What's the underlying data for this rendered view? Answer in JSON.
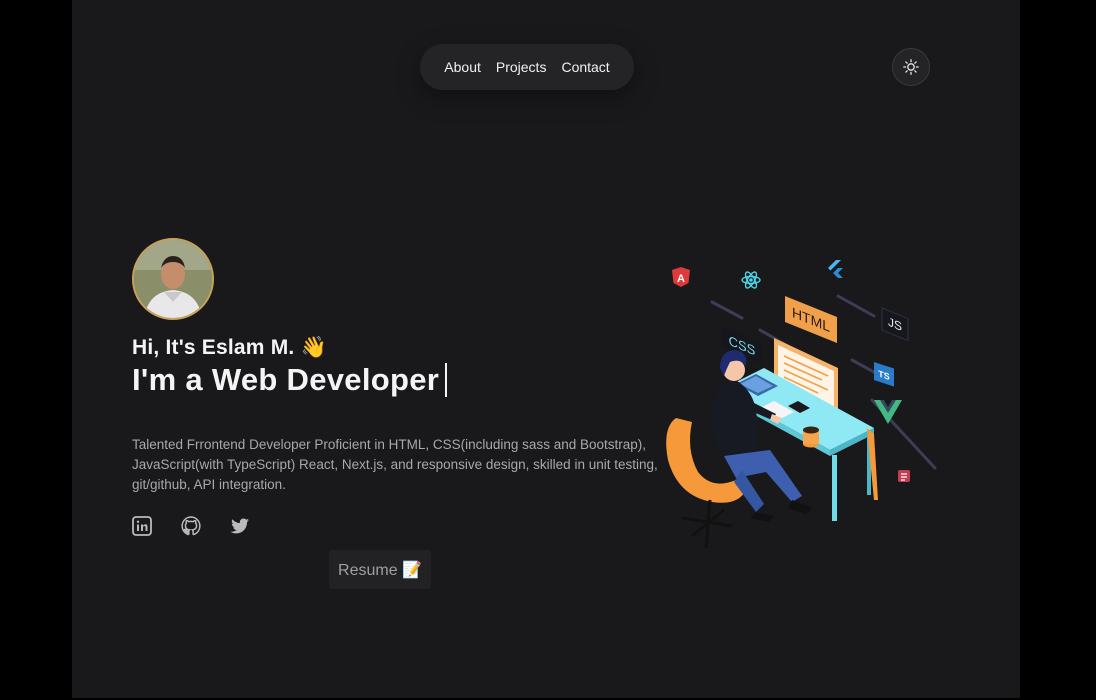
{
  "nav": {
    "items": [
      "About",
      "Projects",
      "Contact"
    ]
  },
  "theme_toggle": {
    "icon": "sun-icon"
  },
  "hero": {
    "greeting": "Hi, It's Eslam M. 👋",
    "role": "I'm a Web Developer",
    "description": "Talented Frrontend Developer Proficient in HTML, CSS(including sass and Bootstrap), JavaScript(with TypeScript) React, Next.js, and responsive design, skilled in unit testing, git/github, API integration.",
    "resume_label": "Resume 📝"
  },
  "socials": [
    "linkedin-icon",
    "github-icon",
    "twitter-icon"
  ],
  "illustration": {
    "tags": [
      "HTML",
      "CSS",
      "JS",
      "TS"
    ]
  },
  "colors": {
    "background": "#19191b",
    "outer": "#000000",
    "text": "#f4f4f5",
    "muted": "#a8a8ad",
    "accent_orange": "#f5a04a",
    "accent_cyan": "#7fe3f0"
  }
}
